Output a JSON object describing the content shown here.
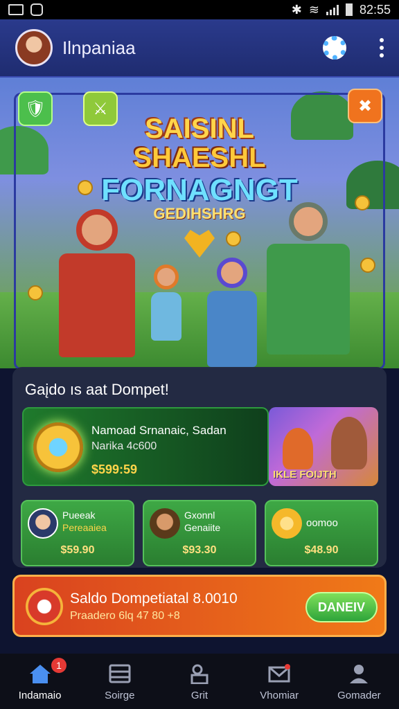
{
  "status_bar": {
    "time": "82:55"
  },
  "header": {
    "title": "Ilnpaniaa"
  },
  "hero": {
    "title_line1": "SAISINL",
    "title_line2": "SHAESHL",
    "title_line3": "FORNAGNGT",
    "subtitle": "GEDIHSHRG"
  },
  "wallet": {
    "heading": "Gaįdo ıs aat Dompet!",
    "promo": {
      "title": "Namoad Srnanaic, Sadan",
      "subtitle": "Narika 4c600",
      "price": "$599:59",
      "thumb_label": "IKLE FOIJTH"
    },
    "items": [
      {
        "name_line1": "Pueeak",
        "name_line2": "Pereaaiea",
        "price": "$59.90"
      },
      {
        "name_line1": "Gxonnl",
        "name_line2": "Genaiite",
        "price": "$93.30"
      },
      {
        "name_line1": "oomoo",
        "name_line2": "",
        "price": "$48.90"
      }
    ]
  },
  "banner": {
    "title": "Saldo Dompetiatal 8.0010",
    "subtitle": "Praadero 6lq 47 80 +8",
    "button_label": "DANEIV"
  },
  "nav": {
    "badge_count": "1",
    "items": [
      {
        "label": "Indamaio"
      },
      {
        "label": "Soirge"
      },
      {
        "label": "Grit"
      },
      {
        "label": "Vhomiar"
      },
      {
        "label": "Gomader"
      }
    ]
  },
  "colors": {
    "header_bg": "#2a3a8c",
    "accent_green": "#3ea845",
    "accent_orange": "#f07a18",
    "badge_red": "#e53935",
    "gold": "#ffd54a"
  },
  "icons": {
    "settings": "gear-icon",
    "menu": "kebab-menu-icon",
    "home": "home-icon",
    "store": "store-icon",
    "gift": "gift-icon",
    "mail": "mail-icon",
    "profile": "profile-icon"
  }
}
